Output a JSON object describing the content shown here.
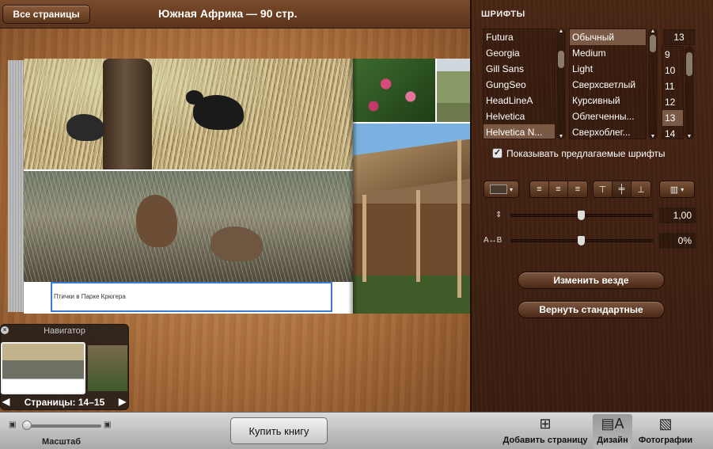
{
  "topbar": {
    "back_label": "Все страницы",
    "title": "Южная Африка — 90 стр."
  },
  "spread": {
    "caption": "Птички в Парке Крюгера"
  },
  "navigator": {
    "title": "Навигатор",
    "pages": "Страницы: 14–15"
  },
  "panel": {
    "title": "ШРИФТЫ",
    "fonts": [
      "Futura",
      "Georgia",
      "Gill Sans",
      "GungSeo",
      "HeadLineA",
      "Helvetica",
      "Helvetica N..."
    ],
    "selected_font": "Helvetica N...",
    "styles": [
      "Обычный",
      "Medium",
      "Light",
      "Сверхсветлый",
      "Курсивный",
      "Облегченны...",
      "Сверхоблег..."
    ],
    "selected_style": "Обычный",
    "size_value": "13",
    "sizes": [
      "9",
      "10",
      "11",
      "12",
      "13",
      "14"
    ],
    "selected_size": "13",
    "show_suggested_label": "Показывать предлагаемые шрифты",
    "show_suggested_checked": true,
    "line_spacing_value": "1,00",
    "line_spacing_fraction": 0.5,
    "char_spacing_value": "0%",
    "char_spacing_fraction": 0.5,
    "char_spacing_icon": "A↔B",
    "apply_everywhere_label": "Изменить везде",
    "reset_defaults_label": "Вернуть стандартные"
  },
  "bottombar": {
    "zoom_label": "Масштаб",
    "zoom_fraction": 0.0,
    "buy_label": "Купить книгу",
    "add_page_label": "Добавить страницу",
    "design_label": "Дизайн",
    "photos_label": "Фотографии"
  },
  "icons": {
    "close": "close-icon",
    "prev": "arrow-left-icon",
    "next": "arrow-right-icon",
    "add_page": "add-page-icon",
    "design": "design-icon",
    "photos": "photos-icon"
  }
}
